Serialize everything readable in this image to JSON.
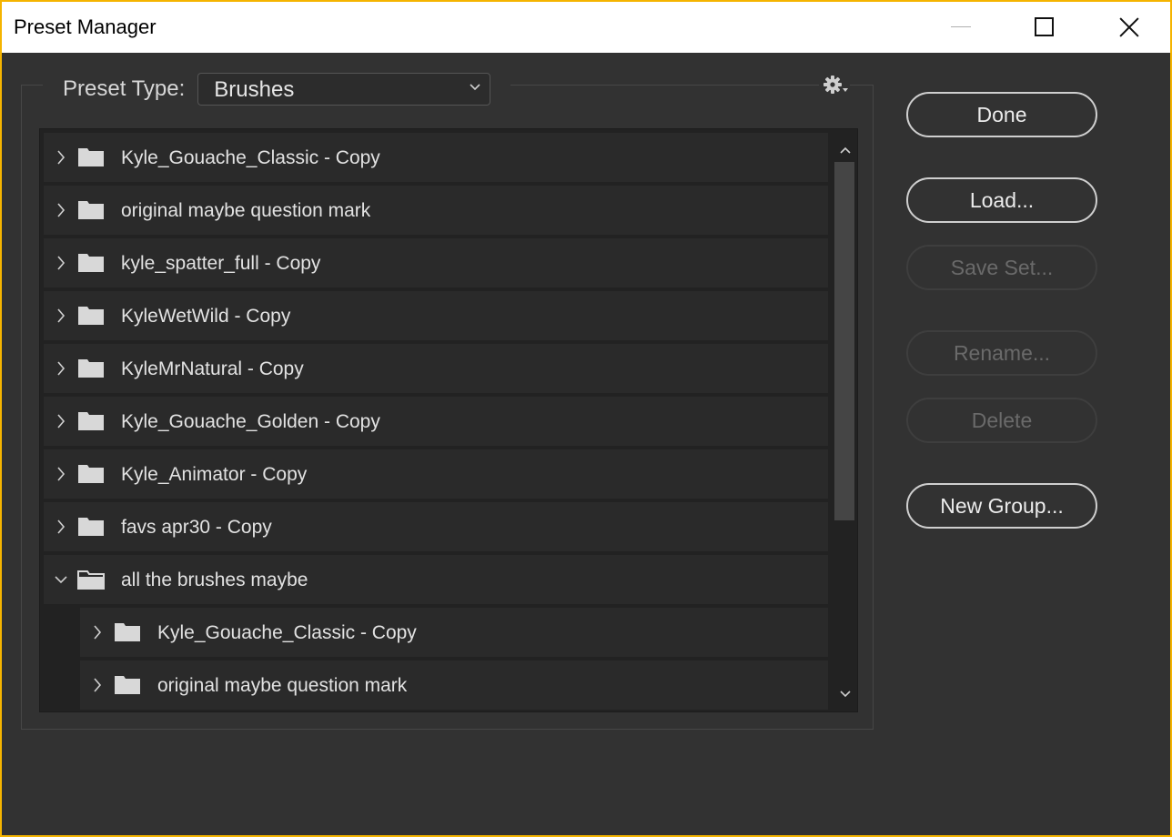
{
  "window": {
    "title": "Preset Manager"
  },
  "preset_type": {
    "label": "Preset Type:",
    "value": "Brushes"
  },
  "list": {
    "rows": [
      {
        "label": "Kyle_Gouache_Classic - Copy",
        "expanded": false,
        "indent": 0
      },
      {
        "label": "original maybe question mark",
        "expanded": false,
        "indent": 0
      },
      {
        "label": "kyle_spatter_full - Copy",
        "expanded": false,
        "indent": 0
      },
      {
        "label": "KyleWetWild - Copy",
        "expanded": false,
        "indent": 0
      },
      {
        "label": "KyleMrNatural - Copy",
        "expanded": false,
        "indent": 0
      },
      {
        "label": "Kyle_Gouache_Golden - Copy",
        "expanded": false,
        "indent": 0
      },
      {
        "label": "Kyle_Animator - Copy",
        "expanded": false,
        "indent": 0
      },
      {
        "label": "favs apr30 - Copy",
        "expanded": false,
        "indent": 0
      },
      {
        "label": "all the brushes maybe",
        "expanded": true,
        "indent": 0
      },
      {
        "label": "Kyle_Gouache_Classic - Copy",
        "expanded": false,
        "indent": 1
      },
      {
        "label": "original maybe question mark",
        "expanded": false,
        "indent": 1
      }
    ]
  },
  "buttons": {
    "done": "Done",
    "load": "Load...",
    "save_set": "Save Set...",
    "rename": "Rename...",
    "delete": "Delete",
    "new_group": "New Group..."
  },
  "icons": {
    "minimize": "minimize-icon",
    "maximize": "maximize-icon",
    "close": "close-icon",
    "gear": "gear-icon",
    "folder": "folder-icon",
    "folder_open": "folder-open-icon",
    "chevron_right": "chevron-right-icon",
    "chevron_down": "chevron-down-icon"
  },
  "colors": {
    "window_border": "#f5b400",
    "background": "#323232",
    "row": "#2a2a2a",
    "text": "#e2e2e2"
  }
}
